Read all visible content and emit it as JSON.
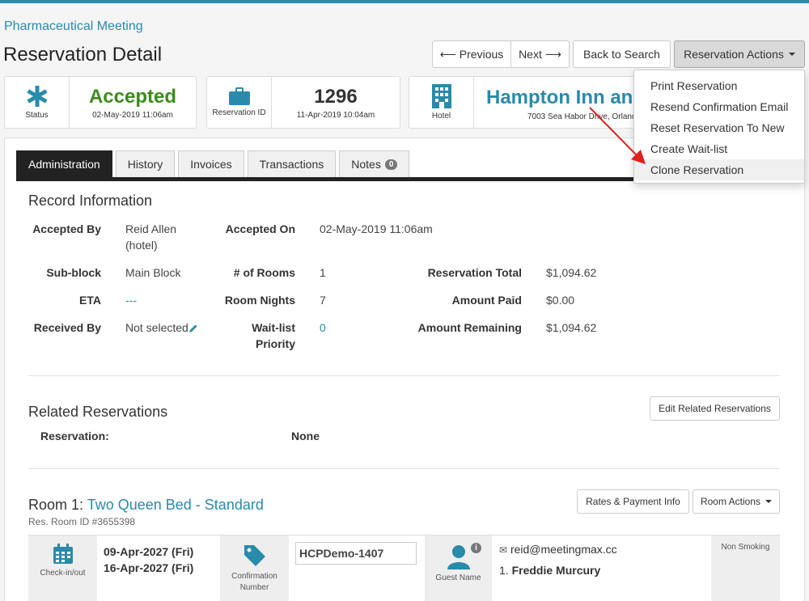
{
  "header": {
    "event_name": "Pharmaceutical Meeting",
    "page_title": "Reservation Detail"
  },
  "nav": {
    "previous": "Previous",
    "next": "Next",
    "back": "Back to Search",
    "actions": "Reservation Actions"
  },
  "status_card": {
    "label": "Status",
    "value": "Accepted",
    "date": "02-May-2019 11:06am",
    "color": "#3c8a1e"
  },
  "id_card": {
    "label": "Reservation ID",
    "value": "1296",
    "date": "11-Apr-2019 10:04am"
  },
  "hotel_card": {
    "label": "Hotel",
    "name": "Hampton Inn and",
    "address": "7003 Sea Habor Drive, Orland"
  },
  "tabs": [
    {
      "label": "Administration"
    },
    {
      "label": "History"
    },
    {
      "label": "Invoices"
    },
    {
      "label": "Transactions"
    },
    {
      "label": "Notes",
      "badge": "0"
    }
  ],
  "record": {
    "title": "Record Information",
    "accepted_by_label": "Accepted By",
    "accepted_by_line1": "Reid Allen",
    "accepted_by_line2": "(hotel)",
    "accepted_on_label": "Accepted On",
    "accepted_on": "02-May-2019 11:06am",
    "subblock_label": "Sub-block",
    "subblock": "Main Block",
    "rooms_label": "# of Rooms",
    "rooms": "1",
    "res_total_label": "Reservation Total",
    "res_total": "$1,094.62",
    "eta_label": "ETA",
    "eta": "---",
    "room_nights_label": "Room Nights",
    "room_nights": "7",
    "amount_paid_label": "Amount Paid",
    "amount_paid": "$0.00",
    "received_by_label": "Received By",
    "received_by": "Not selected",
    "waitlist_label_1": "Wait-list",
    "waitlist_label_2": "Priority",
    "waitlist": "0",
    "amount_remaining_label": "Amount Remaining",
    "amount_remaining": "$1,094.62"
  },
  "related": {
    "title": "Related Reservations",
    "edit_button": "Edit Related Reservations",
    "reservation_label": "Reservation:",
    "reservation_value": "None"
  },
  "room": {
    "title_prefix": "Room 1:",
    "title_link": "Two Queen Bed - Standard",
    "res_room_id": "Res. Room ID #3655398",
    "rates_button": "Rates & Payment Info",
    "actions_button": "Room Actions",
    "checkin_label": "Check-in/out",
    "checkin": "09-Apr-2027 (Fri)",
    "checkout": "16-Apr-2027 (Fri)",
    "confirmation_label_1": "Confirmation",
    "confirmation_label_2": "Number",
    "confirmation_value": "HCPDemo-1407",
    "guest_label": "Guest Name",
    "guest_email": "reid@meetingmax.cc",
    "guest_name_prefix": "1.",
    "guest_name": "Freddie Murcury",
    "smoking": "Non Smoking"
  },
  "dropdown": {
    "items": [
      {
        "label": "Print Reservation"
      },
      {
        "label": "Resend Confirmation Email"
      },
      {
        "label": "Reset Reservation To New"
      },
      {
        "label": "Create Wait-list"
      },
      {
        "label": "Clone Reservation"
      }
    ]
  },
  "colors": {
    "accent": "#2a8aab",
    "status_green": "#3c8a1e",
    "arrow_red": "#e02020"
  }
}
